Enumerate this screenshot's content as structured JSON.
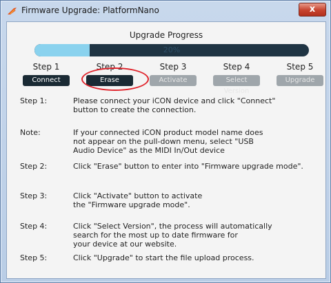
{
  "window": {
    "title": "Firmware Upgrade: PlatformNano",
    "close_glyph": "x"
  },
  "progress": {
    "title": "Upgrade Progress",
    "value_percent": 20,
    "label": "20%"
  },
  "steps": [
    {
      "label": "Step 1",
      "button": "Connect",
      "state": "active"
    },
    {
      "label": "Step 2",
      "button": "Erase",
      "state": "active"
    },
    {
      "label": "Step 3",
      "button": "Activate",
      "state": "disabled"
    },
    {
      "label": "Step 4",
      "button": "Select Version",
      "state": "disabled"
    },
    {
      "label": "Step 5",
      "button": "Upgrade",
      "state": "disabled"
    }
  ],
  "instructions": [
    {
      "label": "Step 1:",
      "text": "Please connect your iCON device and click \"Connect\"\nbutton to create the connection."
    },
    {
      "label": "Note:",
      "text": "If your connected iCON product model name does\nnot appear on the pull-down menu, select \"USB\nAudio Device\" as the MIDI In/Out device"
    },
    {
      "label": "Step 2:",
      "text": "Click \"Erase\" button to enter into \"Firmware upgrade mode\"."
    },
    {
      "label": "Step 3:",
      "text": "Click \"Activate\" button to activate\nthe \"Firmware upgrade mode\"."
    },
    {
      "label": "Step 4:",
      "text": "Click \"Select Version\", the process will automatically\nsearch for the most up to date firmware for\nyour device at our website."
    },
    {
      "label": "Step 5:",
      "text": "Click \"Upgrade\" to start the file upload process."
    }
  ],
  "colors": {
    "progress_fill": "#8ad2ee",
    "progress_track": "#1f3443",
    "active_button": "#1a2a34",
    "disabled_button": "#9fa6ab",
    "highlight": "#e0242c"
  }
}
